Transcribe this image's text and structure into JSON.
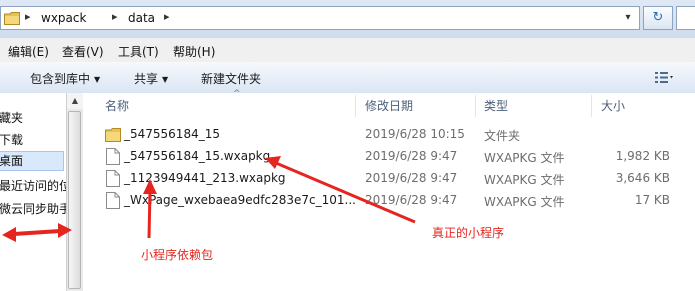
{
  "address_bar": {
    "sep_root": "▸",
    "crumbs": [
      "wxpack",
      "data"
    ],
    "sep": "▸",
    "dropdown_glyph": "▾",
    "refresh_glyph": "↻",
    "folder_icon": "folder-icon"
  },
  "menu": {
    "items": [
      "编辑(E)",
      "查看(V)",
      "工具(T)",
      "帮助(H)"
    ]
  },
  "toolbar": {
    "include_label": "包含到库中",
    "share_label": "共享",
    "new_folder_label": "新建文件夹",
    "arrow": "▼"
  },
  "nav": {
    "items": [
      "藏夹",
      "下载",
      "桌面",
      "最近访问的位",
      "微云同步助手"
    ],
    "selected_index": 2,
    "scroll_up": "▲"
  },
  "columns": {
    "name": "名称",
    "modified": "修改日期",
    "type": "类型",
    "size": "大小",
    "sort_indicator": "^"
  },
  "files": [
    {
      "name": "_547556184_15",
      "modified": "2019/6/28 10:15",
      "type": "文件夹",
      "size": "",
      "icon": "folder-icon"
    },
    {
      "name": "_547556184_15.wxapkg",
      "modified": "2019/6/28 9:47",
      "type": "WXAPKG 文件",
      "size": "1,982 KB",
      "icon": "file-icon"
    },
    {
      "name": "_1123949441_213.wxapkg",
      "modified": "2019/6/28 9:47",
      "type": "WXAPKG 文件",
      "size": "3,646 KB",
      "icon": "file-icon"
    },
    {
      "name": "_WxPage_wxebaea9edfc283e7c_101...",
      "modified": "2019/6/28 9:47",
      "type": "WXAPKG 文件",
      "size": "17 KB",
      "icon": "file-icon"
    }
  ],
  "annotations": {
    "dependency_label": "小程序依赖包",
    "real_label": "真正的小程序",
    "color": "#e5261e"
  }
}
